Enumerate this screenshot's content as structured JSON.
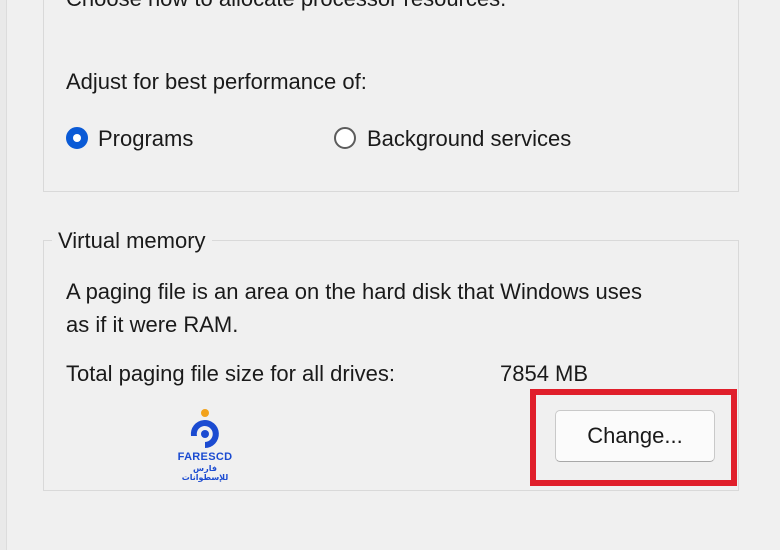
{
  "performance": {
    "clipped_heading": "Choose how to allocate processor resources.",
    "adjust_label": "Adjust for best performance of:",
    "options": [
      {
        "label": "Programs",
        "selected": true
      },
      {
        "label": "Background services",
        "selected": false
      }
    ]
  },
  "virtual_memory": {
    "legend": "Virtual memory",
    "description_line1": "A paging file is an area on the hard disk that Windows uses",
    "description_line2": "as if it were RAM.",
    "total_label": "Total paging file size for all drives:",
    "total_value": "7854 MB",
    "change_button": "Change..."
  },
  "watermark": {
    "name": "FARESCD",
    "arabic": "فارس للإسطوانات"
  },
  "colors": {
    "accent": "#0a5ad6",
    "highlight": "#e01f2b",
    "brand": "#1b4bd1"
  }
}
